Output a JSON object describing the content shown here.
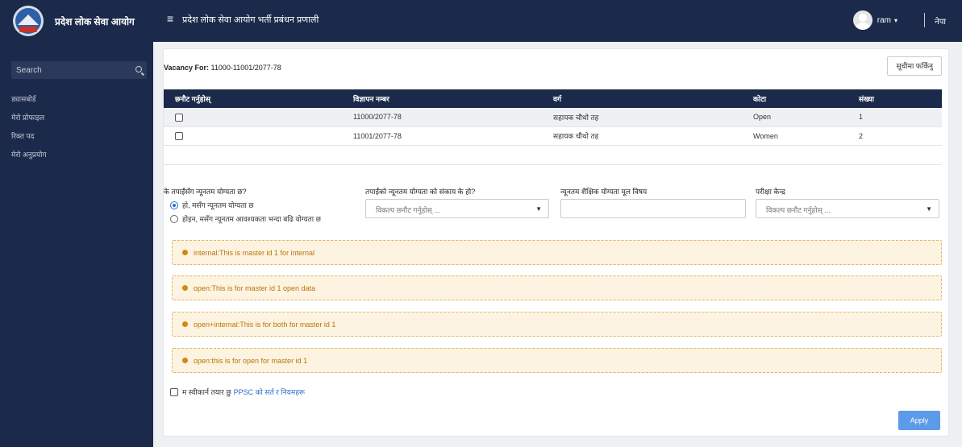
{
  "header": {
    "org_name": "प्रदेश लोक सेवा आयोग",
    "app_title": "प्रदेश लोक सेवा आयोग भर्ती प्रबंधन प्रणाली",
    "user_name": "ram",
    "language": "नेपा"
  },
  "sidebar": {
    "search_placeholder": "Search",
    "items": [
      {
        "label": "ड्यासबोर्ड"
      },
      {
        "label": "मेरो प्रोफाइल"
      },
      {
        "label": "रिक्त पद"
      },
      {
        "label": "मेरो अनुप्रयोग"
      }
    ]
  },
  "vacancy": {
    "prefix": "Vacancy For:",
    "code": "11000-11001/2077-78",
    "back_button": "सूचीमा फर्किनु"
  },
  "table": {
    "headers": [
      "छनौट गर्नुहोस्",
      "विज्ञापन नम्बर",
      "वर्ग",
      "कोटा",
      "संख्या"
    ],
    "rows": [
      {
        "ad_no": "11000/2077-78",
        "category": "सहायक चौथो तह",
        "quota": "Open",
        "count": "1"
      },
      {
        "ad_no": "11001/2077-78",
        "category": "सहायक चौथो तह",
        "quota": "Women",
        "count": "2"
      }
    ]
  },
  "form": {
    "q1_label": "के तपाईंसँग न्यूनतम योग्यता छ?",
    "q1_options": [
      "हो, मसँग न्यूनतम योग्यता छ",
      "होइन, मसँग न्यूनतम आवश्यकता भन्दा बढि योग्यता छ"
    ],
    "q2_label": "तपाईंको न्यूनतम योग्यता को संकाय के हो?",
    "q2_placeholder": "विकल्प छनौट गर्नुहोस् ...",
    "q3_label": "न्यूनतम शैक्षिक योग्यता मूल विषय",
    "q3_value": "",
    "q4_label": "परीक्षा केन्द्र",
    "q4_placeholder": "विकल्प छनौट गर्नुहोस् ..."
  },
  "alerts": [
    "internal:This is master id 1 for internal",
    "open:This is for master id 1 open data",
    "open+internal:This is for both for master id 1",
    "open:this is for open for master id 1"
  ],
  "agreement": {
    "text": "म स्वीकार्न तयार छु",
    "link": "PPSC को सर्त र नियमहरू"
  },
  "apply_button": "Apply",
  "colors": {
    "navy": "#1b2a4a",
    "apply": "#5b9bea",
    "alert_bg": "#fcf3e0",
    "alert_text": "#b8760c",
    "link": "#2a6fc9"
  }
}
